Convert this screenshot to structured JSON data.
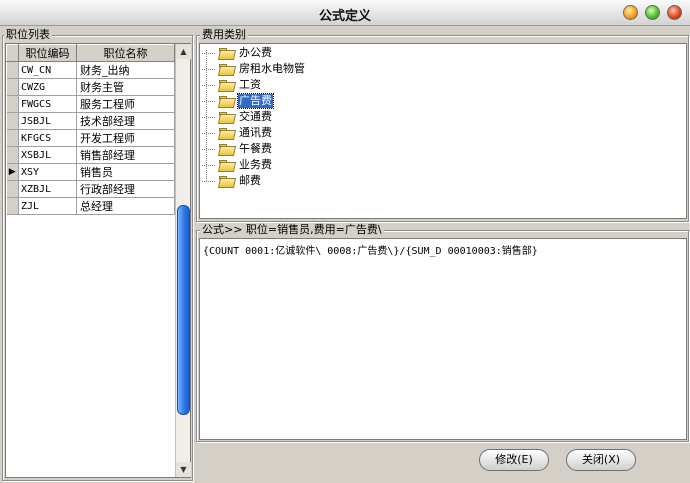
{
  "window": {
    "title": "公式定义"
  },
  "left_panel": {
    "label": "职位列表",
    "columns": [
      "职位编码",
      "职位名称"
    ],
    "rows": [
      {
        "code": "CW_CN",
        "name": "财务_出纳"
      },
      {
        "code": "CWZG",
        "name": "财务主管"
      },
      {
        "code": "FWGCS",
        "name": "服务工程师"
      },
      {
        "code": "JSBJL",
        "name": "技术部经理"
      },
      {
        "code": "KFGCS",
        "name": "开发工程师"
      },
      {
        "code": "XSBJL",
        "name": "销售部经理"
      },
      {
        "code": "XSY",
        "name": "销售员"
      },
      {
        "code": "XZBJL",
        "name": "行政部经理"
      },
      {
        "code": "ZJL",
        "name": "总经理"
      }
    ],
    "selected_row": 6,
    "current_row_marker": "▶"
  },
  "tree_panel": {
    "label": "费用类别",
    "items": [
      "办公费",
      "房租水电物管",
      "工资",
      "广告费",
      "交通费",
      "通讯费",
      "午餐费",
      "业务费",
      "邮费"
    ],
    "selected_index": 3
  },
  "formula_panel": {
    "label": "公式>> 职位=销售员,费用=广告费\\",
    "text": "{COUNT 0001:亿诚软件\\ 0008:广告费\\}/{SUM_D 00010003:销售部}"
  },
  "buttons": {
    "modify": "修改(E)",
    "close": "关闭(X)"
  },
  "scrollbar": {
    "up_icon": "▲",
    "down_icon": "▼"
  },
  "colors": {
    "selection": "#316ac5",
    "scroll_thumb": "#2f78e6"
  }
}
